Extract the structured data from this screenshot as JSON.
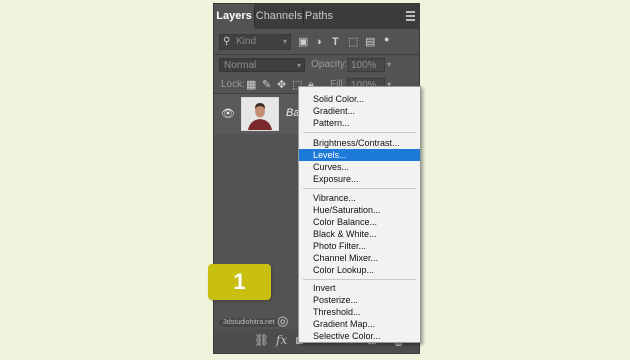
{
  "panel": {
    "tabs": [
      "Layers",
      "Channels",
      "Paths"
    ],
    "filter": {
      "placeholder": "Kind"
    },
    "blend_mode": "Normal",
    "opacity_label": "Opacity:",
    "opacity_value": "100%",
    "lock_label": "Lock:",
    "fill_label": "Fill:",
    "fill_value": "100%",
    "layer_name": "Ba",
    "watermark": "3dstudiohitra.net"
  },
  "step_badge": "1",
  "menu": {
    "groups": [
      [
        "Solid Color...",
        "Gradient...",
        "Pattern..."
      ],
      [
        "Brightness/Contrast...",
        "Levels...",
        "Curves...",
        "Exposure..."
      ],
      [
        "Vibrance...",
        "Hue/Saturation...",
        "Color Balance...",
        "Black & White...",
        "Photo Filter...",
        "Channel Mixer...",
        "Color Lookup..."
      ],
      [
        "Invert",
        "Posterize...",
        "Threshold...",
        "Gradient Map...",
        "Selective Color..."
      ]
    ],
    "selected": "Levels..."
  },
  "colors": {
    "accent": "#1e7ad9",
    "badge": "#c9bf11",
    "panel": "#535353",
    "background": "#f0f4dc"
  },
  "icons": {
    "filter_row": [
      "search-icon",
      "pixel-filter-icon",
      "adjustment-filter-icon",
      "type-filter-icon",
      "shape-filter-icon",
      "smart-object-filter-icon",
      "filter-toggle-icon"
    ],
    "lock_row": [
      "lock-transparent-icon",
      "lock-paint-icon",
      "lock-move-icon",
      "lock-artboard-icon",
      "lock-all-icon"
    ],
    "bottom_bar": [
      "link-icon",
      "fx-icon",
      "mask-icon",
      "adjustment-icon",
      "folder-icon",
      "new-layer-icon",
      "trash-icon"
    ]
  }
}
